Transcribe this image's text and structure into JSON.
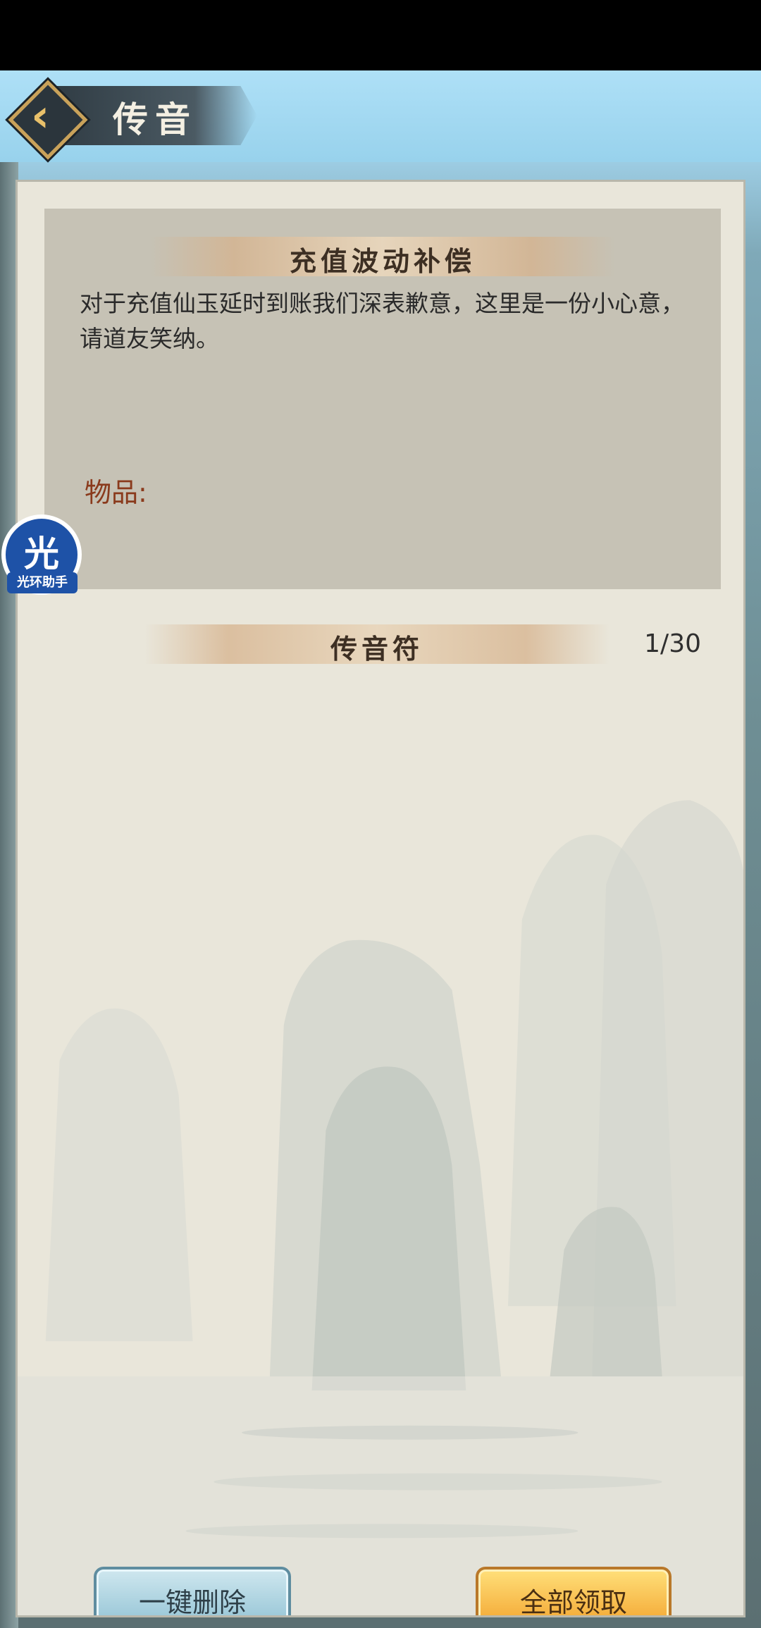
{
  "header": {
    "title": "传音",
    "back_icon": "chevron-left-icon"
  },
  "message": {
    "subject": "充值波动补偿",
    "body": "对于充值仙玉延时到账我们深表歉意，这里是一份小心意，请道友笑纳。",
    "items_label": "物品:"
  },
  "list": {
    "section_title": "传音符",
    "count": "1/30"
  },
  "overlay": {
    "assistant_glyph": "光",
    "assistant_label": "光环助手"
  },
  "actions": {
    "delete_all": "一键删除",
    "claim_all": "全部领取"
  },
  "colors": {
    "sky": "#a9d8f0",
    "panel": "#e9e6da",
    "claim_button": "#f2a12c",
    "delete_button": "#8fc1d3",
    "items_label": "#8a3a1c"
  }
}
